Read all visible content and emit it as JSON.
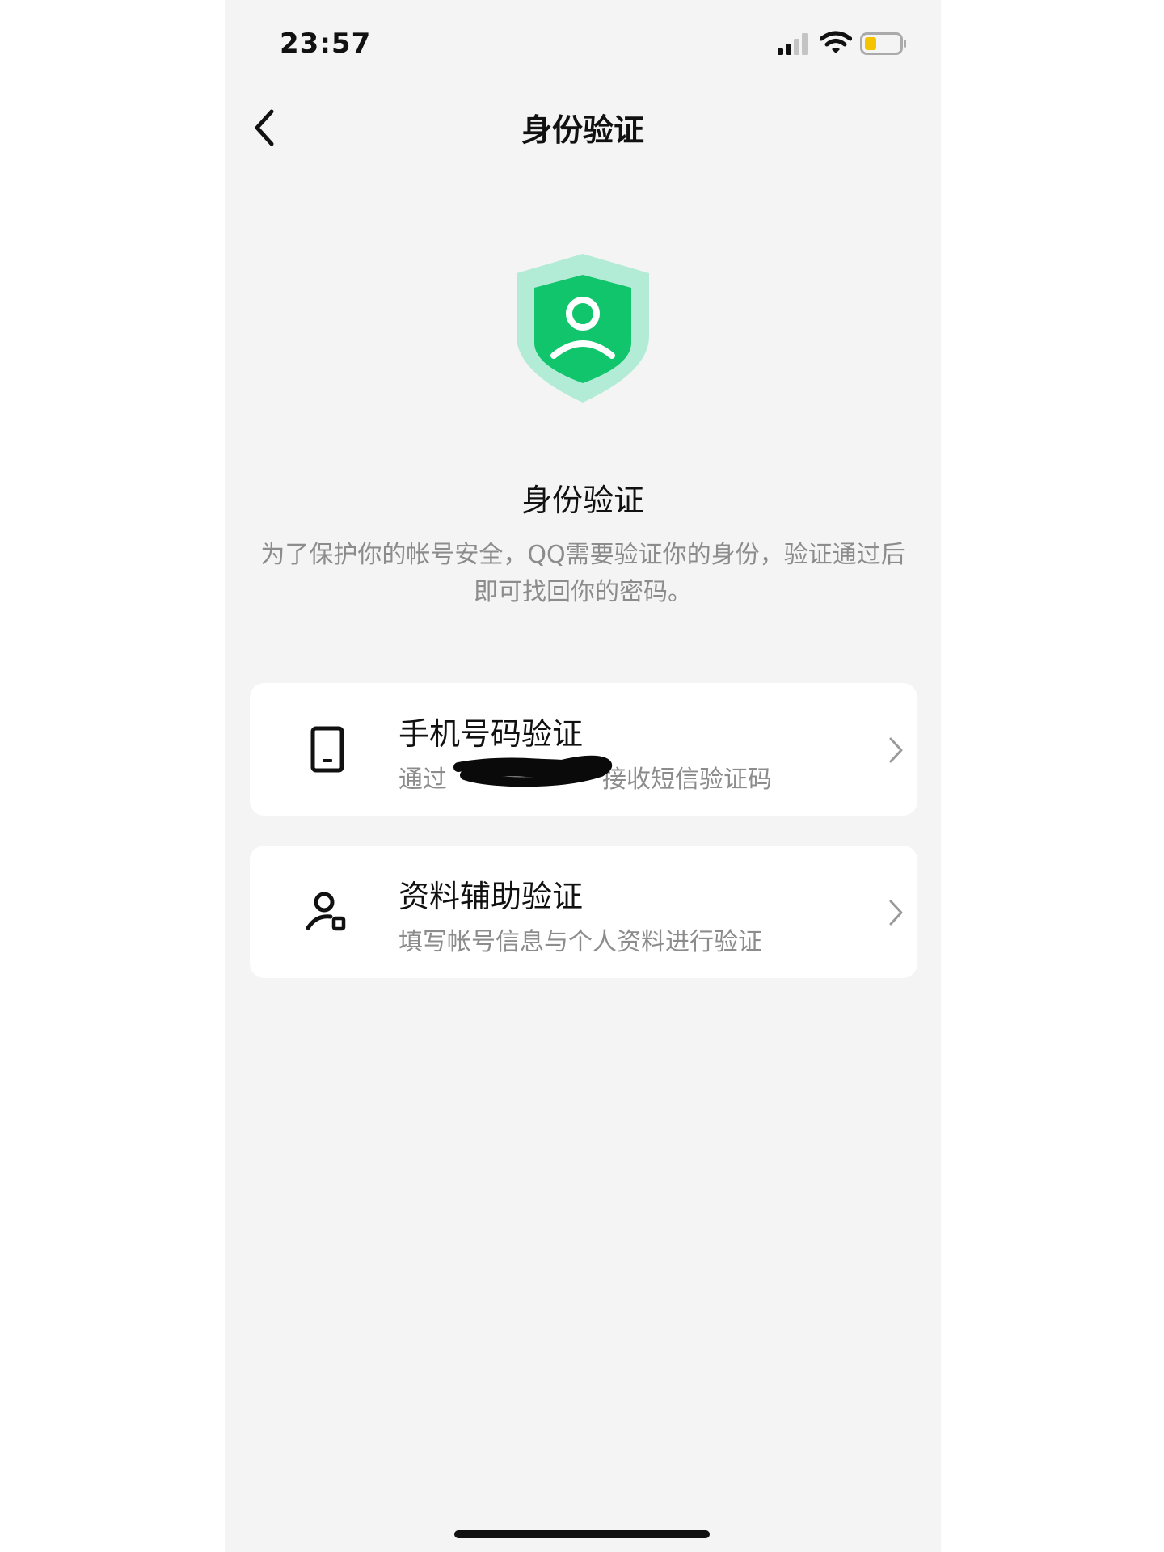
{
  "status_bar": {
    "time": "23:57",
    "icons": [
      "cellular-signal-icon",
      "wifi-icon",
      "battery-low-icon"
    ],
    "battery_color": "#f5c400"
  },
  "nav": {
    "title": "身份验证",
    "back_icon": "chevron-left-icon"
  },
  "hero": {
    "icon": "shield-user-icon",
    "heading": "身份验证",
    "description": "为了保护你的帐号安全，QQ需要验证你的身份，验证通过后即可找回你的密码。",
    "colors": {
      "shield_outer": "#b3ecd6",
      "shield_inner": "#10c56c"
    }
  },
  "options": [
    {
      "icon": "phone-icon",
      "title": "手机号码验证",
      "subtitle_prefix": "通过",
      "subtitle_suffix": "接收短信验证码"
    },
    {
      "icon": "user-profile-icon",
      "title": "资料辅助验证",
      "subtitle": "填写帐号信息与个人资料进行验证"
    }
  ]
}
